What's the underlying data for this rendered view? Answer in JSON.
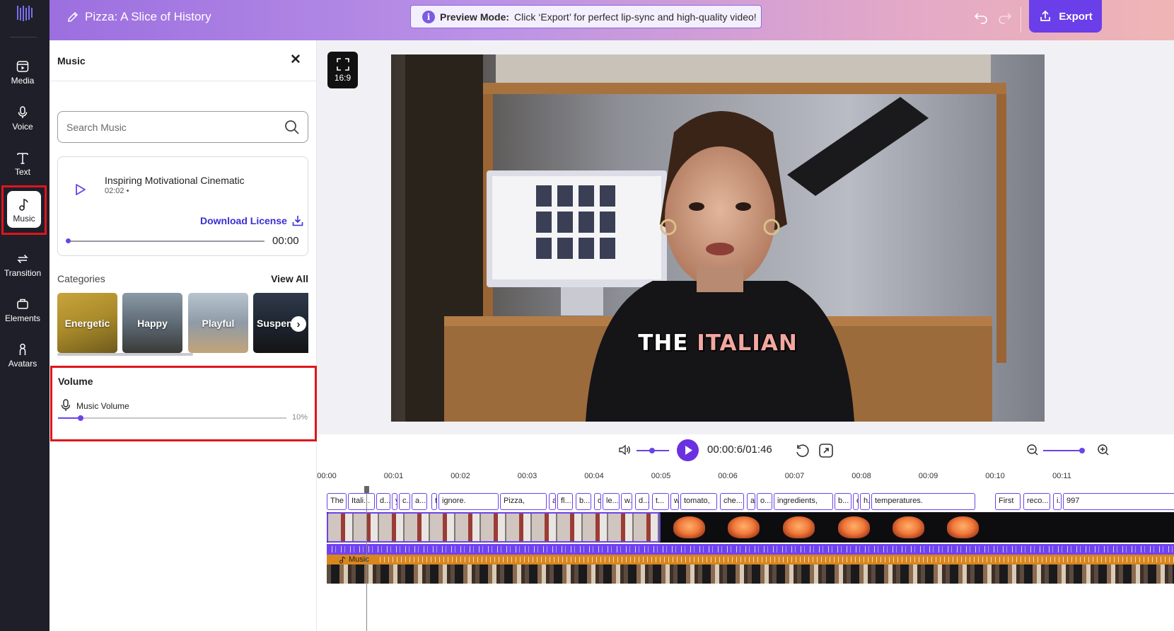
{
  "header": {
    "project_title": "Pizza: A Slice of History",
    "banner_bold": "Preview Mode:",
    "banner_text": "Click ‘Export’ for perfect lip-sync and high-quality video!",
    "export_label": "Export"
  },
  "rail": {
    "items": [
      {
        "label": "Media",
        "icon": "media-icon"
      },
      {
        "label": "Voice",
        "icon": "microphone-icon"
      },
      {
        "label": "Text",
        "icon": "text-icon"
      },
      {
        "label": "Music",
        "icon": "music-note-icon",
        "active": true
      },
      {
        "label": "Transition",
        "icon": "transition-icon"
      },
      {
        "label": "Elements",
        "icon": "elements-icon"
      },
      {
        "label": "Avatars",
        "icon": "avatar-icon"
      }
    ]
  },
  "panel": {
    "title": "Music",
    "search_placeholder": "Search Music",
    "track": {
      "name": "Inspiring Motivational Cinematic",
      "duration": "02:02 •",
      "download_label": "Download License",
      "time": "00:00"
    },
    "categories_label": "Categories",
    "view_all": "View All",
    "categories": [
      "Energetic",
      "Happy",
      "Playful",
      "Suspense"
    ],
    "volume": {
      "title": "Volume",
      "label": "Music Volume",
      "value_percent": 10,
      "value_text": "10%"
    }
  },
  "stage": {
    "aspect_ratio": "16:9",
    "caption_white": "THE",
    "caption_highlight": "ITALIAN"
  },
  "controls": {
    "timecode": "00:00:6/01:46"
  },
  "timeline": {
    "ticks": [
      "00:00",
      "00:01",
      "00:02",
      "00:03",
      "00:04",
      "00:05",
      "00:06",
      "00:07",
      "00:08",
      "00:09",
      "00:10",
      "00:11"
    ],
    "words": [
      "The",
      "Itali...",
      "d...",
      "y",
      "c...",
      "a...",
      "t",
      "ignore.",
      "Pizza,",
      "a",
      "fl...",
      "b...",
      "o",
      "le...",
      "w.",
      "d...",
      "t...",
      "w",
      "tomato,",
      "che...",
      "a.",
      "o...",
      "ingredients,",
      "b...",
      "o",
      "h.",
      "temperatures.",
      "First",
      "reco...",
      "i.",
      "997"
    ],
    "music_label": "Music"
  },
  "colors": {
    "accent": "#6b43e8",
    "export_button": "#6a3ee8",
    "highlight_box": "#e0151b",
    "rail_bg": "#1f1f29",
    "music_track": "#d9861c",
    "voice_track": "#7043f0"
  }
}
